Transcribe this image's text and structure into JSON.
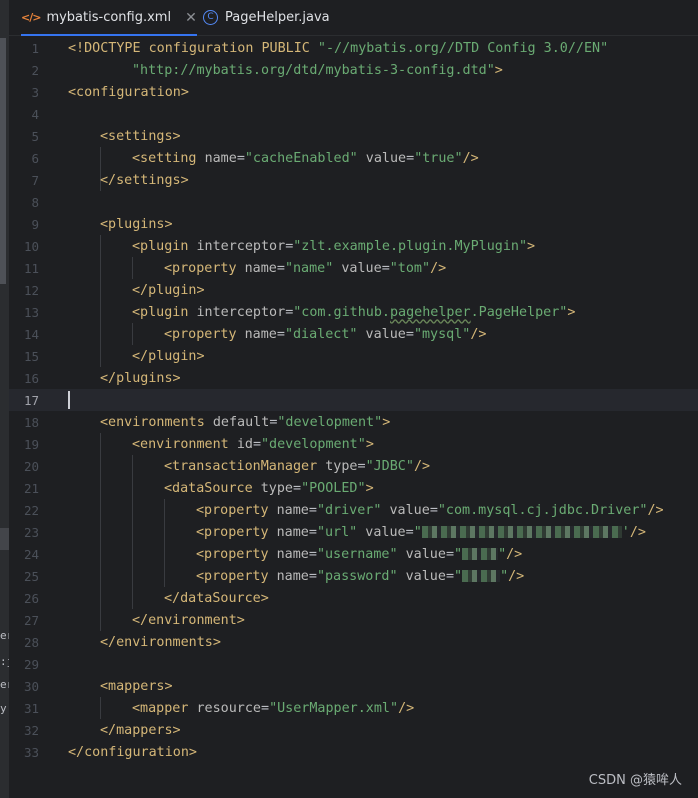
{
  "tabs": [
    {
      "label": "mybatis-config.xml",
      "icon": "xml-file-icon",
      "active": true
    },
    {
      "label": "PageHelper.java",
      "icon": "java-class-icon",
      "active": false
    }
  ],
  "left_fragments": [
    "er",
    ":j",
    "er",
    "y"
  ],
  "editor": {
    "current_line": 17,
    "line_numbers": [
      "1",
      "2",
      "3",
      "4",
      "5",
      "6",
      "7",
      "8",
      "9",
      "10",
      "11",
      "12",
      "13",
      "14",
      "15",
      "16",
      "17",
      "18",
      "19",
      "20",
      "21",
      "22",
      "23",
      "24",
      "25",
      "26",
      "27",
      "28",
      "29",
      "30",
      "31",
      "32",
      "33"
    ],
    "lines": {
      "l1": {
        "a": "<!DOCTYPE configuration PUBLIC ",
        "b": "\"-//mybatis.org//DTD Config 3.0//EN\""
      },
      "l2": {
        "a": "\"http://mybatis.org/dtd/mybatis-3-config.dtd\"",
        "b": ">"
      },
      "l3": {
        "a": "<configuration>"
      },
      "l5": {
        "a": "<settings>"
      },
      "l6": {
        "a": "<setting ",
        "b": "name",
        "c": "=",
        "d": "\"cacheEnabled\"",
        "e": " value",
        "f": "=",
        "g": "\"true\"",
        "h": "/>"
      },
      "l7": {
        "a": "</settings>"
      },
      "l9": {
        "a": "<plugins>"
      },
      "l10": {
        "a": "<plugin ",
        "b": "interceptor",
        "c": "=",
        "d": "\"zlt.example.plugin.MyPlugin\"",
        "e": ">"
      },
      "l11": {
        "a": "<property ",
        "b": "name",
        "c": "=",
        "d": "\"name\"",
        "e": " value",
        "f": "=",
        "g": "\"tom\"",
        "h": "/>"
      },
      "l12": {
        "a": "</plugin>"
      },
      "l13": {
        "a": "<plugin ",
        "b": "interceptor",
        "c": "=",
        "d1": "\"com.github.",
        "d2": "pagehelper",
        "d3": ".PageHelper\"",
        "e": ">"
      },
      "l14": {
        "a": "<property ",
        "b": "name",
        "c": "=",
        "d": "\"dialect\"",
        "e": " value",
        "f": "=",
        "g": "\"mysql\"",
        "h": "/>"
      },
      "l15": {
        "a": "</plugin>"
      },
      "l16": {
        "a": "</plugins>"
      },
      "l18": {
        "a": "<environments ",
        "b": "default",
        "c": "=",
        "d": "\"development\"",
        "e": ">"
      },
      "l19": {
        "a": "<environment ",
        "b": "id",
        "c": "=",
        "d": "\"development\"",
        "e": ">"
      },
      "l20": {
        "a": "<transactionManager ",
        "b": "type",
        "c": "=",
        "d": "\"JDBC\"",
        "e": "/>"
      },
      "l21": {
        "a": "<dataSource ",
        "b": "type",
        "c": "=",
        "d": "\"POOLED\"",
        "e": ">"
      },
      "l22": {
        "a": "<property ",
        "b": "name",
        "c": "=",
        "d": "\"driver\"",
        "e": " value",
        "f": "=",
        "g": "\"com.mysql.cj.jdbc.Driver\"",
        "h": "/>"
      },
      "l23": {
        "a": "<property ",
        "b": "name",
        "c": "=",
        "d": "\"url\"",
        "e": " value",
        "f": "=",
        "g1": "\"",
        "g2": "'",
        "h": "/>"
      },
      "l24": {
        "a": "<property ",
        "b": "name",
        "c": "=",
        "d": "\"username\"",
        "e": " value",
        "f": "=",
        "g1": "\"",
        "g2": "\"",
        "h": "/>"
      },
      "l25": {
        "a": "<property ",
        "b": "name",
        "c": "=",
        "d": "\"password\"",
        "e": " value",
        "f": "=",
        "g1": "\"",
        "g2": "\"",
        "h": "/>"
      },
      "l26": {
        "a": "</dataSource>"
      },
      "l27": {
        "a": "</environment>"
      },
      "l28": {
        "a": "</environments>"
      },
      "l30": {
        "a": "<mappers>"
      },
      "l31": {
        "a": "<mapper ",
        "b": "resource",
        "c": "=",
        "d": "\"UserMapper.xml\"",
        "e": "/>"
      },
      "l32": {
        "a": "</mappers>"
      },
      "l33": {
        "a": "</configuration>"
      }
    }
  },
  "watermark": "CSDN @猿哞人",
  "colors": {
    "background": "#1e1f22",
    "tag": "#d5b778",
    "attribute": "#bababa",
    "string": "#6aab73",
    "accent": "#3574f0"
  }
}
